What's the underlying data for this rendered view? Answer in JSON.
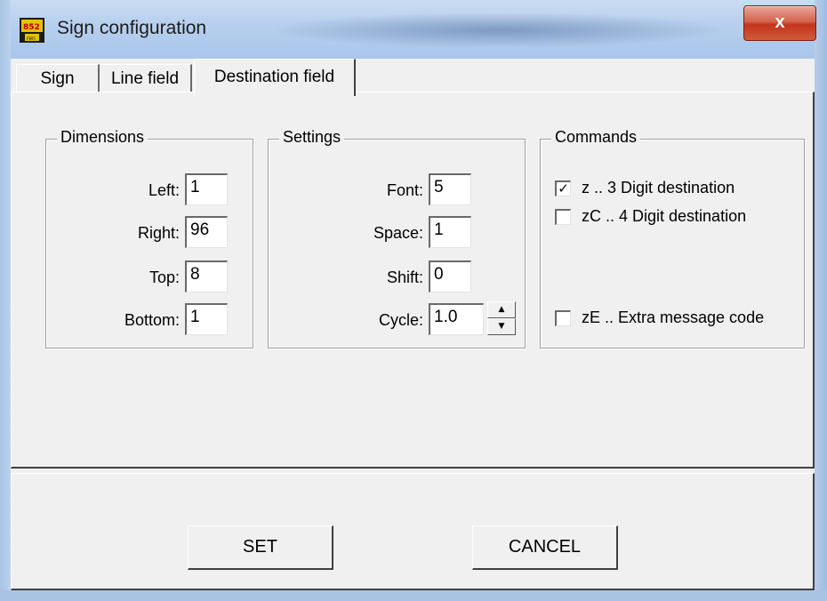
{
  "window": {
    "title": "Sign configuration",
    "close_label": "x"
  },
  "tabs": [
    {
      "label": "Sign",
      "active": false
    },
    {
      "label": "Line field",
      "active": false
    },
    {
      "label": "Destination field",
      "active": true
    }
  ],
  "dimensions": {
    "title": "Dimensions",
    "left": {
      "label": "Left:",
      "value": "1"
    },
    "right": {
      "label": "Right:",
      "value": "96"
    },
    "top": {
      "label": "Top:",
      "value": "8"
    },
    "bottom": {
      "label": "Bottom:",
      "value": "1"
    }
  },
  "settings": {
    "title": "Settings",
    "font": {
      "label": "Font:",
      "value": "5"
    },
    "space": {
      "label": "Space:",
      "value": "1"
    },
    "shift": {
      "label": "Shift:",
      "value": "0"
    },
    "cycle": {
      "label": "Cycle:",
      "value": "1.0"
    }
  },
  "commands": {
    "title": "Commands",
    "items": [
      {
        "label": "z  .. 3 Digit destination",
        "checked": true
      },
      {
        "label": "zC .. 4 Digit destination",
        "checked": false
      },
      {
        "label": "zE .. Extra message code",
        "checked": false
      }
    ]
  },
  "buttons": {
    "set": "SET",
    "cancel": "CANCEL"
  },
  "colors": {
    "close_button": "#c2341c",
    "face": "#f0f0f0",
    "title_bar": "#b8d0ee"
  }
}
